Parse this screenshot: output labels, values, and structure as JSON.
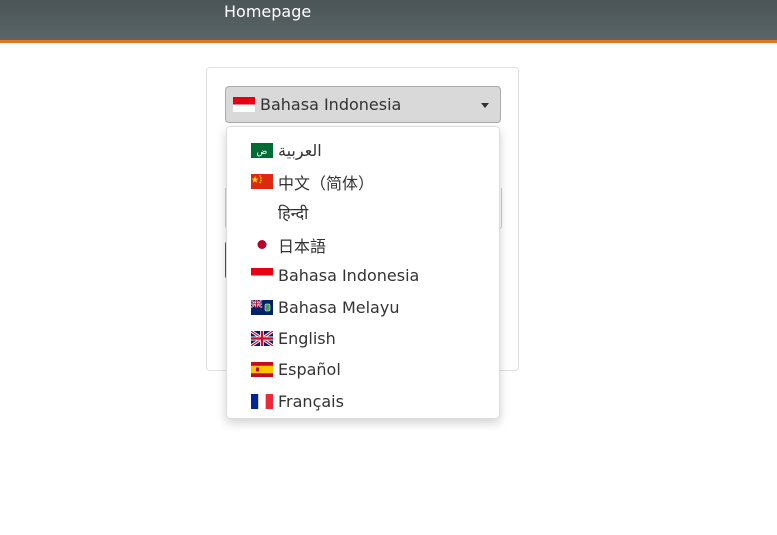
{
  "header": {
    "title": "Homepage",
    "accent_color": "#e6751f",
    "bar_color": "#4e595b"
  },
  "language_select": {
    "selected_label": "Bahasa Indonesia",
    "selected_flag": "indonesia-flag-icon"
  },
  "languages": [
    {
      "label": "العربية",
      "flag": "saudi-arabia-flag-icon"
    },
    {
      "label": "中文（简体）",
      "flag": "china-flag-icon"
    },
    {
      "label": "हिन्दी",
      "flag": "none"
    },
    {
      "label": "日本語",
      "flag": "japan-flag-icon"
    },
    {
      "label": "Bahasa Indonesia",
      "flag": "indonesia-flag-icon"
    },
    {
      "label": "Bahasa Melayu",
      "flag": "malaysia-flag-icon"
    },
    {
      "label": "English",
      "flag": "uk-flag-icon"
    },
    {
      "label": "Español",
      "flag": "spain-flag-icon"
    },
    {
      "label": "Français",
      "flag": "france-flag-icon"
    }
  ]
}
